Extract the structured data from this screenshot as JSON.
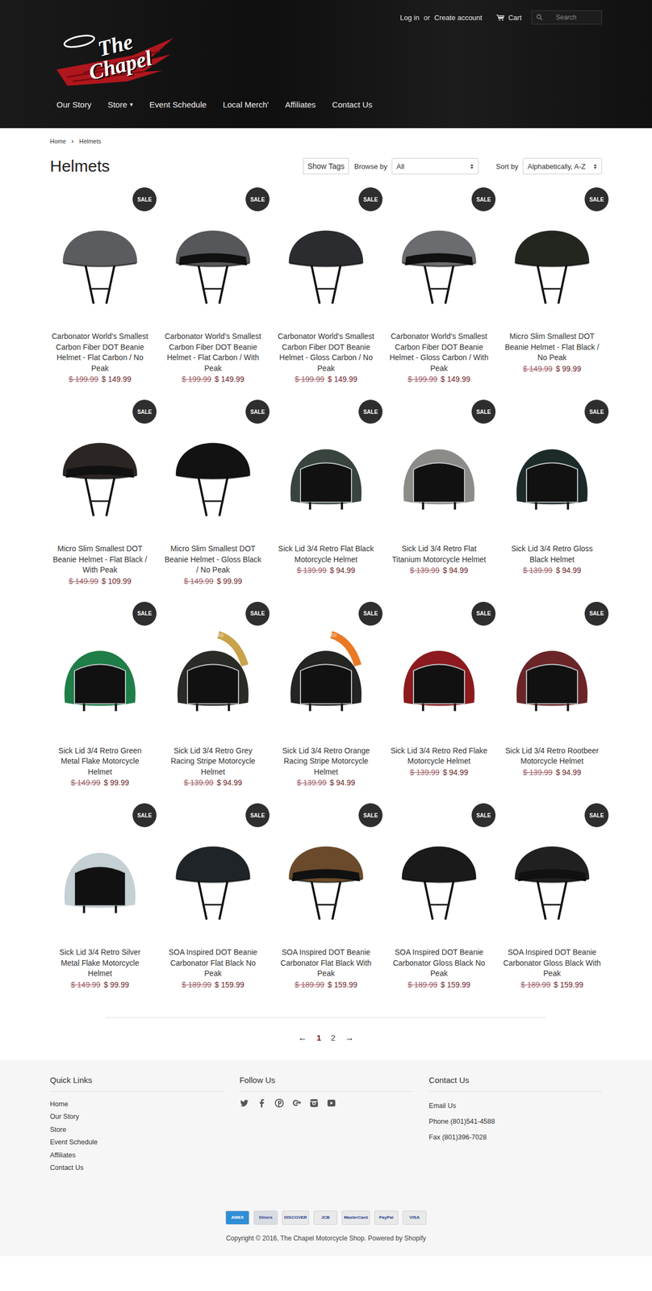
{
  "header": {
    "login": "Log in",
    "or": "or",
    "create_account": "Create account",
    "cart": "Cart",
    "search_placeholder": "Search",
    "logo": "The Chapel"
  },
  "nav": {
    "dropdown_icon": "▾",
    "items": [
      {
        "label": "Our Story",
        "dropdown": false
      },
      {
        "label": "Store",
        "dropdown": true
      },
      {
        "label": "Event Schedule",
        "dropdown": false
      },
      {
        "label": "Local Merch'",
        "dropdown": false
      },
      {
        "label": "Affiliates",
        "dropdown": false
      },
      {
        "label": "Contact Us",
        "dropdown": false
      }
    ]
  },
  "breadcrumb": {
    "items": [
      "Home",
      "Helmets"
    ],
    "separator": "›"
  },
  "collection": {
    "title": "Helmets",
    "show_tags": "Show Tags",
    "browse_label": "Browse by",
    "browse_value": "All",
    "sort_label": "Sort by",
    "sort_value": "Alphabetically, A-Z"
  },
  "products": [
    {
      "title": "Carbonator World's Smallest Carbon Fiber DOT Beanie Helmet - Flat Carbon / No Peak",
      "old_price": "$ 199.99",
      "price": "$ 149.99",
      "badge": "SALE",
      "kind": "beanie",
      "peak": false,
      "color": "#5a5c60",
      "stripe": null
    },
    {
      "title": "Carbonator World's Smallest Carbon Fiber DOT Beanie Helmet - Flat Carbon / With Peak",
      "old_price": "$ 199.99",
      "price": "$ 149.99",
      "badge": "SALE",
      "kind": "beanie",
      "peak": true,
      "color": "#55575b",
      "stripe": null
    },
    {
      "title": "Carbonator World's Smallest Carbon Fiber DOT Beanie Helmet - Gloss Carbon / No Peak",
      "old_price": "$ 199.99",
      "price": "$ 149.99",
      "badge": "SALE",
      "kind": "beanie",
      "peak": false,
      "color": "#2a2c30",
      "stripe": null
    },
    {
      "title": "Carbonator World's Smallest Carbon Fiber DOT Beanie Helmet - Gloss Carbon / With Peak",
      "old_price": "$ 199.99",
      "price": "$ 149.99",
      "badge": "SALE",
      "kind": "beanie",
      "peak": true,
      "color": "#6a6c70",
      "stripe": null
    },
    {
      "title": "Micro Slim Smallest DOT Beanie Helmet - Flat Black / No Peak",
      "old_price": "$ 149.99",
      "price": "$ 99.99",
      "badge": "SALE",
      "kind": "beanie",
      "peak": false,
      "color": "#23261f",
      "stripe": null
    },
    {
      "title": "Micro Slim Smallest DOT Beanie Helmet - Flat Black / With Peak",
      "old_price": "$ 149.99",
      "price": "$ 109.99",
      "badge": "SALE",
      "kind": "beanie",
      "peak": true,
      "color": "#2b2624",
      "stripe": null
    },
    {
      "title": "Micro Slim Smallest DOT Beanie Helmet - Gloss Black / No Peak",
      "old_price": "$ 149.99",
      "price": "$ 99.99",
      "badge": "SALE",
      "kind": "beanie",
      "peak": false,
      "color": "#121212",
      "stripe": null
    },
    {
      "title": "Sick Lid 3/4 Retro Flat Black Motorcycle Helmet",
      "old_price": "$ 139.99",
      "price": "$ 94.99",
      "badge": "SALE",
      "kind": "open-face",
      "peak": false,
      "color": "#39443f",
      "stripe": null
    },
    {
      "title": "Sick Lid 3/4 Retro Flat Titanium Motorcycle Helmet",
      "old_price": "$ 139.99",
      "price": "$ 94.99",
      "badge": "SALE",
      "kind": "open-face",
      "peak": false,
      "color": "#8b8b88",
      "stripe": null
    },
    {
      "title": "Sick Lid 3/4 Retro Gloss Black Helmet",
      "old_price": "$ 139.99",
      "price": "$ 94.99",
      "badge": "SALE",
      "kind": "open-face",
      "peak": false,
      "color": "#1d2a2a",
      "stripe": null
    },
    {
      "title": "Sick Lid 3/4 Retro Green Metal Flake Motorcycle Helmet",
      "old_price": "$ 149.99",
      "price": "$ 99.99",
      "badge": "SALE",
      "kind": "open-face",
      "peak": false,
      "color": "#1f7d47",
      "stripe": null
    },
    {
      "title": "Sick Lid 3/4 Retro Grey Racing Stripe Motorcycle Helmet",
      "old_price": "$ 139.99",
      "price": "$ 94.99",
      "badge": "SALE",
      "kind": "open-face",
      "peak": false,
      "color": "#2a2a26",
      "stripe": "#c9a24a"
    },
    {
      "title": "Sick Lid 3/4 Retro Orange Racing Stripe Motorcycle Helmet",
      "old_price": "$ 139.99",
      "price": "$ 94.99",
      "badge": "SALE",
      "kind": "open-face",
      "peak": false,
      "color": "#242422",
      "stripe": "#ea7a25"
    },
    {
      "title": "Sick Lid 3/4 Retro Red Flake Motorcycle Helmet",
      "old_price": "$ 139.99",
      "price": "$ 94.99",
      "badge": "SALE",
      "kind": "open-face",
      "peak": false,
      "color": "#8c1a1f",
      "stripe": null
    },
    {
      "title": "Sick Lid 3/4 Retro Rootbeer Motorcycle Helmet",
      "old_price": "$ 139.99",
      "price": "$ 94.99",
      "badge": "SALE",
      "kind": "open-face",
      "peak": false,
      "color": "#6b2527",
      "stripe": null
    },
    {
      "title": "Sick Lid 3/4 Retro Silver Metal Flake Motorcycle Helmet",
      "old_price": "$ 149.99",
      "price": "$ 99.99",
      "badge": "SALE",
      "kind": "open-face",
      "peak": false,
      "color": "#c5d0d5",
      "stripe": null
    },
    {
      "title": "SOA Inspired DOT Beanie Carbonator Flat Black No Peak",
      "old_price": "$ 189.99",
      "price": "$ 159.99",
      "badge": "SALE",
      "kind": "beanie",
      "peak": false,
      "color": "#1f2428",
      "stripe": null
    },
    {
      "title": "SOA Inspired DOT Beanie Carbonator Flat Black With Peak",
      "old_price": "$ 189.99",
      "price": "$ 159.99",
      "badge": "SALE",
      "kind": "beanie",
      "peak": true,
      "color": "#6a4a2b",
      "stripe": null
    },
    {
      "title": "SOA Inspired DOT Beanie Carbonator Gloss Black No Peak",
      "old_price": "$ 189.99",
      "price": "$ 159.99",
      "badge": "SALE",
      "kind": "beanie",
      "peak": false,
      "color": "#1a1a1a",
      "stripe": null
    },
    {
      "title": "SOA Inspired DOT Beanie Carbonator Gloss Black With Peak",
      "old_price": "$ 189.99",
      "price": "$ 159.99",
      "badge": "SALE",
      "kind": "beanie",
      "peak": true,
      "color": "#202020",
      "stripe": null
    }
  ],
  "pagination": {
    "prev": "←",
    "next": "→",
    "pages": [
      {
        "label": "1",
        "selected": true
      },
      {
        "label": "2",
        "selected": false
      }
    ]
  },
  "footer": {
    "quick_links": {
      "title": "Quick Links",
      "items": [
        "Home",
        "Our Story",
        "Store",
        "Event Schedule",
        "Affiliates",
        "Contact Us"
      ]
    },
    "follow": {
      "title": "Follow Us"
    },
    "contact": {
      "title": "Contact Us",
      "items": [
        "Email Us",
        "Phone (801)541-4588",
        "Fax (801)396-7028"
      ]
    },
    "payments": [
      {
        "label": "AMEX",
        "color": "#2f8fd6"
      },
      {
        "label": "Diners",
        "color": "#d8dde3"
      },
      {
        "label": "DISCOVER",
        "color": "#e9e9e9"
      },
      {
        "label": "JCB",
        "color": "#e9e9e9"
      },
      {
        "label": "MasterCard",
        "color": "#e9e9e9"
      },
      {
        "label": "PayPal",
        "color": "#e9e9e9"
      },
      {
        "label": "VISA",
        "color": "#e9e9e9"
      }
    ],
    "copyright": "Copyright © 2016, The Chapel Motorcycle Shop. Powered by Shopify"
  }
}
